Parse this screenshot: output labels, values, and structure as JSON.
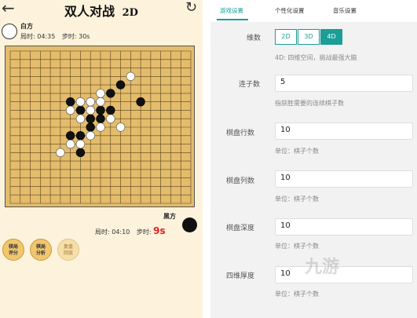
{
  "game": {
    "title": "双人对战",
    "mode": "2D",
    "white": {
      "name": "白方",
      "total_label": "局时:",
      "total": "04:35",
      "step_label": "步时:",
      "step": "30s"
    },
    "black": {
      "name": "黑方",
      "total_label": "局时:",
      "total": "04:10",
      "step_label": "步时:",
      "step": "9s"
    },
    "buttons": [
      {
        "line1": "棋局",
        "line2": "评分",
        "enabled": true
      },
      {
        "line1": "棋局",
        "line2": "分析",
        "enabled": true
      },
      {
        "line1": "复盘",
        "line2": "回放",
        "enabled": false
      }
    ],
    "board": {
      "size": 19,
      "white_stones": [
        [
          12,
          3
        ],
        [
          9,
          5
        ],
        [
          7,
          6
        ],
        [
          8,
          6
        ],
        [
          9,
          6
        ],
        [
          6,
          7
        ],
        [
          8,
          7
        ],
        [
          7,
          8
        ],
        [
          10,
          8
        ],
        [
          9,
          9
        ],
        [
          11,
          9
        ],
        [
          8,
          10
        ],
        [
          6,
          11
        ],
        [
          7,
          11
        ],
        [
          5,
          12
        ]
      ],
      "black_stones": [
        [
          11,
          4
        ],
        [
          10,
          5
        ],
        [
          6,
          6
        ],
        [
          7,
          7
        ],
        [
          9,
          7
        ],
        [
          8,
          8
        ],
        [
          13,
          6
        ],
        [
          8,
          9
        ],
        [
          6,
          10
        ],
        [
          7,
          10
        ],
        [
          7,
          12
        ],
        [
          10,
          7
        ],
        [
          9,
          8
        ]
      ]
    }
  },
  "settings": {
    "tabs": [
      {
        "label": "游戏设置",
        "active": true
      },
      {
        "label": "个性化设置",
        "active": false
      },
      {
        "label": "音乐设置",
        "active": false
      }
    ],
    "dimension": {
      "label": "维数",
      "options": [
        "2D",
        "3D",
        "4D"
      ],
      "selected": "4D",
      "desc": "4D: 四维空间，挑战最强大脑"
    },
    "connect": {
      "label": "连子数",
      "value": "5",
      "desc": "指获胜需要的连续棋子数"
    },
    "rows": {
      "label": "棋盘行数",
      "value": "10",
      "desc": "单位：棋子个数"
    },
    "cols": {
      "label": "棋盘列数",
      "value": "10",
      "desc": "单位：棋子个数"
    },
    "depth": {
      "label": "棋盘深度",
      "value": "10",
      "desc": "单位：棋子个数"
    },
    "thickness": {
      "label": "四维厚度",
      "value": "10",
      "desc": "单位：棋子个数"
    }
  },
  "watermark": "九游",
  "colors": {
    "accent": "#1a9e96",
    "board": "#e3bc6c",
    "panel_bg": "#fdf3dc"
  }
}
